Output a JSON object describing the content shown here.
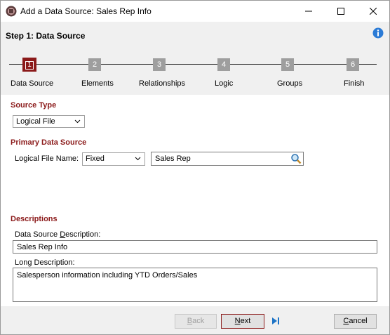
{
  "window": {
    "title": "Add a Data Source: Sales Rep Info",
    "icon": "app-logo-icon",
    "controls": [
      "minimize-icon",
      "maximize-icon",
      "close-icon"
    ]
  },
  "header": {
    "step_title": "Step 1:  Data Source",
    "info_icon": "info-icon"
  },
  "wizard_steps": [
    {
      "number": "1",
      "label": "Data Source",
      "active": true
    },
    {
      "number": "2",
      "label": "Elements",
      "active": false
    },
    {
      "number": "3",
      "label": "Relationships",
      "active": false
    },
    {
      "number": "4",
      "label": "Logic",
      "active": false
    },
    {
      "number": "5",
      "label": "Groups",
      "active": false
    },
    {
      "number": "6",
      "label": "Finish",
      "active": false
    }
  ],
  "source_type": {
    "heading": "Source Type",
    "selected": "Logical File"
  },
  "primary_source": {
    "heading": "Primary Data Source",
    "logical_file_label": "Logical File Name:",
    "mode_selected": "Fixed",
    "file_name_value": "Sales Rep"
  },
  "descriptions": {
    "heading": "Descriptions",
    "ds_desc_label_pre": "Data Source ",
    "ds_desc_label_ul": "D",
    "ds_desc_label_post": "escription:",
    "ds_desc_value": "Sales Rep Info",
    "long_desc_label": "Long Description:",
    "long_desc_value": "Salesperson information including YTD Orders/Sales"
  },
  "footer": {
    "back_ul": "B",
    "back_rest": "ack",
    "next_ul": "N",
    "next_rest": "ext",
    "cancel_ul": "C",
    "cancel_rest": "ancel"
  },
  "colors": {
    "accent": "#8b1a1a",
    "step_inactive": "#9e9e9e",
    "info_blue": "#2b7bd6"
  }
}
